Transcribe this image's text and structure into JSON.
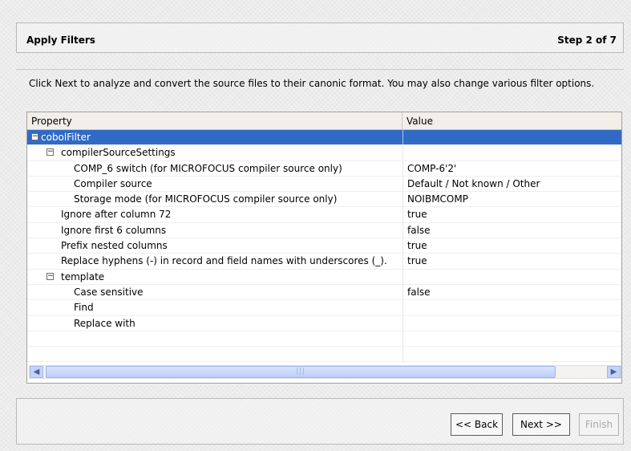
{
  "header": {
    "title": "Apply Filters",
    "step": "Step 2 of 7"
  },
  "instructions": "Click Next to analyze and convert the source files to their canonic format. You may also change various filter options.",
  "table": {
    "columns": [
      "Property",
      "Value"
    ],
    "rows": [
      {
        "label": "cobolFilter",
        "value": "",
        "depth": 0,
        "expandable": true,
        "selected": true
      },
      {
        "label": "compilerSourceSettings",
        "value": "",
        "depth": 1,
        "expandable": true,
        "selected": false
      },
      {
        "label": "COMP_6 switch (for MICROFOCUS compiler source only)",
        "value": "COMP-6'2'",
        "depth": 2,
        "expandable": false,
        "selected": false
      },
      {
        "label": "Compiler source",
        "value": "Default / Not known / Other",
        "depth": 2,
        "expandable": false,
        "selected": false
      },
      {
        "label": "Storage mode (for MICROFOCUS compiler source only)",
        "value": "NOIBMCOMP",
        "depth": 2,
        "expandable": false,
        "selected": false
      },
      {
        "label": "Ignore after column 72",
        "value": "true",
        "depth": 1,
        "expandable": false,
        "selected": false
      },
      {
        "label": "Ignore first 6 columns",
        "value": "false",
        "depth": 1,
        "expandable": false,
        "selected": false
      },
      {
        "label": "Prefix nested columns",
        "value": "true",
        "depth": 1,
        "expandable": false,
        "selected": false
      },
      {
        "label": "Replace hyphens (-) in record and field names with underscores (_).",
        "value": "true",
        "depth": 1,
        "expandable": false,
        "selected": false
      },
      {
        "label": "template",
        "value": "",
        "depth": 1,
        "expandable": true,
        "selected": false
      },
      {
        "label": "Case sensitive",
        "value": "false",
        "depth": 2,
        "expandable": false,
        "selected": false
      },
      {
        "label": "Find",
        "value": "",
        "depth": 2,
        "expandable": false,
        "selected": false
      },
      {
        "label": "Replace with",
        "value": "",
        "depth": 2,
        "expandable": false,
        "selected": false
      },
      {
        "label": "",
        "value": "",
        "depth": 0,
        "expandable": false,
        "selected": false
      },
      {
        "label": "",
        "value": "",
        "depth": 0,
        "expandable": false,
        "selected": false
      }
    ]
  },
  "scrollbar": {
    "left_icon": "arrow-left-icon",
    "right_icon": "arrow-right-icon",
    "thumb_icon": "grip-icon"
  },
  "buttons": {
    "back": "<< Back",
    "next": "Next >>",
    "finish": "Finish"
  },
  "colors": {
    "selection": "#316ac5",
    "background": "#ececec"
  }
}
